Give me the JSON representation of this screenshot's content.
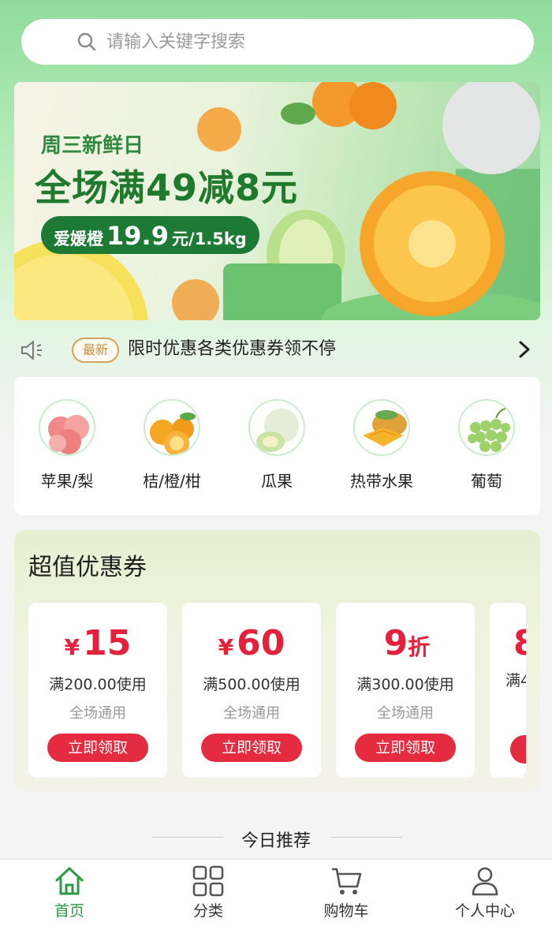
{
  "search": {
    "placeholder": "请输入关键字搜索"
  },
  "banner": {
    "subtitle": "周三新鲜日",
    "title": "全场满49减8元",
    "promo_label": "爱媛橙",
    "promo_price": "19.9",
    "promo_unit": "元/1.5kg"
  },
  "notice": {
    "badge": "最新",
    "text": "限时优惠各类优惠券领不停"
  },
  "categories": [
    {
      "label": "苹果/梨",
      "icon": "apple-pear-icon"
    },
    {
      "label": "桔/橙/柑",
      "icon": "orange-icon"
    },
    {
      "label": "瓜果",
      "icon": "melon-icon"
    },
    {
      "label": "热带水果",
      "icon": "mango-icon"
    },
    {
      "label": "葡萄",
      "icon": "grape-icon"
    }
  ],
  "coupons": {
    "title": "超值优惠券",
    "items": [
      {
        "currency": "¥",
        "amount": "15",
        "unit": "",
        "condition": "满200.00使用",
        "scope": "全场通用",
        "button": "立即领取"
      },
      {
        "currency": "¥",
        "amount": "60",
        "unit": "",
        "condition": "满500.00使用",
        "scope": "全场通用",
        "button": "立即领取"
      },
      {
        "currency": "",
        "amount": "9",
        "unit": "折",
        "condition": "满300.00使用",
        "scope": "全场通用",
        "button": "立即领取"
      },
      {
        "currency": "",
        "amount": "8",
        "unit": "",
        "condition": "满4",
        "scope": "",
        "button": ""
      }
    ]
  },
  "section_heading": "今日推荐",
  "tabbar": [
    {
      "label": "首页",
      "icon": "home-icon",
      "active": true
    },
    {
      "label": "分类",
      "icon": "category-grid-icon",
      "active": false
    },
    {
      "label": "购物车",
      "icon": "cart-icon",
      "active": false
    },
    {
      "label": "个人中心",
      "icon": "user-icon",
      "active": false
    }
  ],
  "colors": {
    "accent_green": "#2c9a44",
    "coupon_red": "#e3213d",
    "badge_gold": "#c98f3e"
  }
}
